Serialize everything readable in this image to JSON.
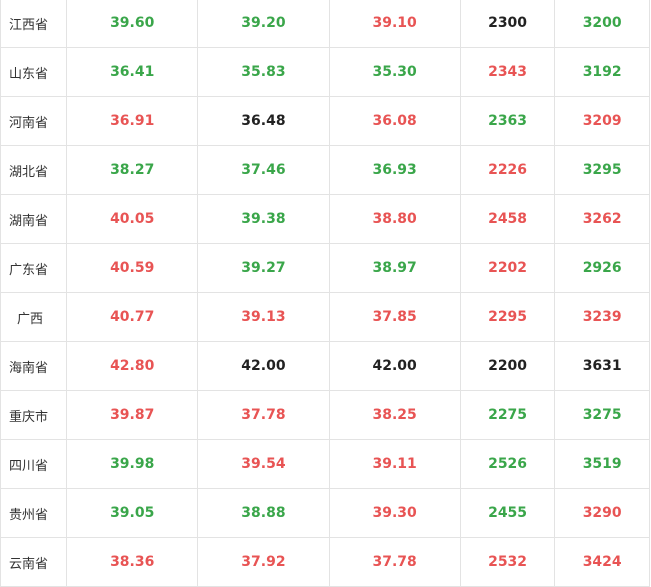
{
  "colors": {
    "up": "#e85454",
    "down": "#3aa64a",
    "flat": "#222222"
  },
  "rows": [
    {
      "region": "江西省",
      "cells": [
        {
          "v": "39.60",
          "c": "green"
        },
        {
          "v": "39.20",
          "c": "green"
        },
        {
          "v": "39.10",
          "c": "red"
        },
        {
          "v": "2300",
          "c": "black"
        },
        {
          "v": "3200",
          "c": "green"
        }
      ]
    },
    {
      "region": "山东省",
      "cells": [
        {
          "v": "36.41",
          "c": "green"
        },
        {
          "v": "35.83",
          "c": "green"
        },
        {
          "v": "35.30",
          "c": "green"
        },
        {
          "v": "2343",
          "c": "red"
        },
        {
          "v": "3192",
          "c": "green"
        }
      ]
    },
    {
      "region": "河南省",
      "cells": [
        {
          "v": "36.91",
          "c": "red"
        },
        {
          "v": "36.48",
          "c": "black"
        },
        {
          "v": "36.08",
          "c": "red"
        },
        {
          "v": "2363",
          "c": "green"
        },
        {
          "v": "3209",
          "c": "red"
        }
      ]
    },
    {
      "region": "湖北省",
      "cells": [
        {
          "v": "38.27",
          "c": "green"
        },
        {
          "v": "37.46",
          "c": "green"
        },
        {
          "v": "36.93",
          "c": "green"
        },
        {
          "v": "2226",
          "c": "red"
        },
        {
          "v": "3295",
          "c": "green"
        }
      ]
    },
    {
      "region": "湖南省",
      "cells": [
        {
          "v": "40.05",
          "c": "red"
        },
        {
          "v": "39.38",
          "c": "green"
        },
        {
          "v": "38.80",
          "c": "red"
        },
        {
          "v": "2458",
          "c": "red"
        },
        {
          "v": "3262",
          "c": "red"
        }
      ]
    },
    {
      "region": "广东省",
      "cells": [
        {
          "v": "40.59",
          "c": "red"
        },
        {
          "v": "39.27",
          "c": "green"
        },
        {
          "v": "38.97",
          "c": "green"
        },
        {
          "v": "2202",
          "c": "red"
        },
        {
          "v": "2926",
          "c": "green"
        }
      ]
    },
    {
      "region": "广西",
      "cells": [
        {
          "v": "40.77",
          "c": "red"
        },
        {
          "v": "39.13",
          "c": "red"
        },
        {
          "v": "37.85",
          "c": "red"
        },
        {
          "v": "2295",
          "c": "red"
        },
        {
          "v": "3239",
          "c": "red"
        }
      ]
    },
    {
      "region": "海南省",
      "cells": [
        {
          "v": "42.80",
          "c": "red"
        },
        {
          "v": "42.00",
          "c": "black"
        },
        {
          "v": "42.00",
          "c": "black"
        },
        {
          "v": "2200",
          "c": "black"
        },
        {
          "v": "3631",
          "c": "black"
        }
      ]
    },
    {
      "region": "重庆市",
      "cells": [
        {
          "v": "39.87",
          "c": "red"
        },
        {
          "v": "37.78",
          "c": "red"
        },
        {
          "v": "38.25",
          "c": "red"
        },
        {
          "v": "2275",
          "c": "green"
        },
        {
          "v": "3275",
          "c": "green"
        }
      ]
    },
    {
      "region": "四川省",
      "cells": [
        {
          "v": "39.98",
          "c": "green"
        },
        {
          "v": "39.54",
          "c": "red"
        },
        {
          "v": "39.11",
          "c": "red"
        },
        {
          "v": "2526",
          "c": "green"
        },
        {
          "v": "3519",
          "c": "green"
        }
      ]
    },
    {
      "region": "贵州省",
      "cells": [
        {
          "v": "39.05",
          "c": "green"
        },
        {
          "v": "38.88",
          "c": "green"
        },
        {
          "v": "39.30",
          "c": "red"
        },
        {
          "v": "2455",
          "c": "green"
        },
        {
          "v": "3290",
          "c": "red"
        }
      ]
    },
    {
      "region": "云南省",
      "cells": [
        {
          "v": "38.36",
          "c": "red"
        },
        {
          "v": "37.92",
          "c": "red"
        },
        {
          "v": "37.78",
          "c": "red"
        },
        {
          "v": "2532",
          "c": "red"
        },
        {
          "v": "3424",
          "c": "red"
        }
      ]
    }
  ]
}
